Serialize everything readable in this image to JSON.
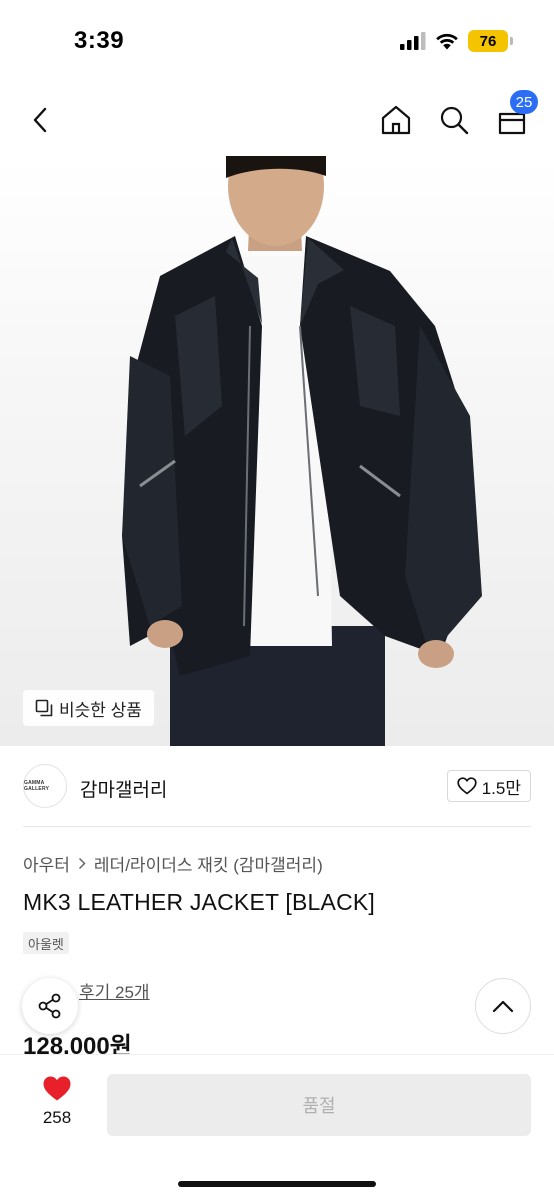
{
  "status_bar": {
    "time": "3:39",
    "battery": "76"
  },
  "nav": {
    "cart_count": "25"
  },
  "product_image": {
    "similar_label": "비슷한 상품"
  },
  "brand": {
    "logo_text": "GAMMA GALLERY",
    "name": "감마갤러리",
    "likes": "1.5만"
  },
  "product": {
    "breadcrumb": [
      "아우터",
      "레더/라이더스 재킷 (감마갤러리)"
    ],
    "title": "MK3 LEATHER JACKET [BLACK]",
    "tag": "아울렛",
    "review_label": "후기 25개",
    "price": "128,000원"
  },
  "bottom_bar": {
    "wish_count": "258",
    "soldout_label": "품절"
  },
  "colors": {
    "accent_blue": "#2b6ef5",
    "heart_red": "#e8202a",
    "battery_yellow": "#f5c400"
  }
}
